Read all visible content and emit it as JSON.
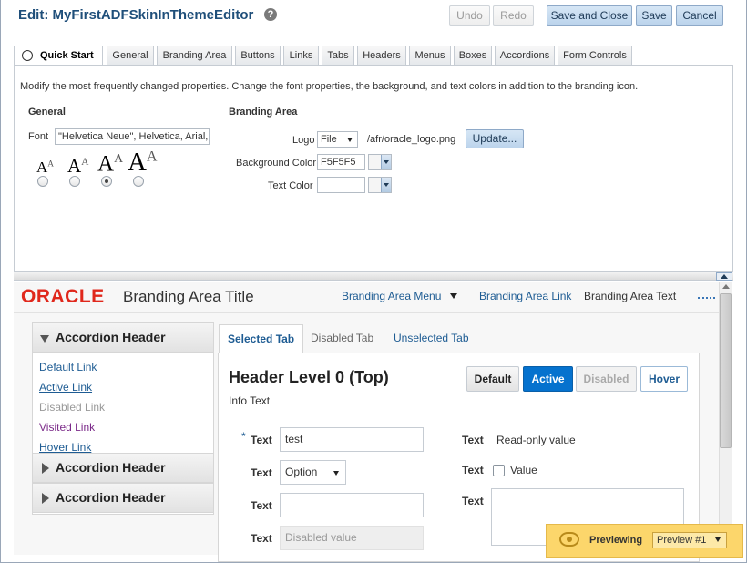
{
  "header": {
    "title": "Edit: MyFirstADFSkinInThemeEditor",
    "help_icon": "?",
    "undo_label": "Undo",
    "redo_label": "Redo",
    "save_close_label": "Save and Close",
    "save_label": "Save",
    "cancel_label": "Cancel"
  },
  "tabs": [
    "Quick Start",
    "General",
    "Branding Area",
    "Buttons",
    "Links",
    "Tabs",
    "Headers",
    "Menus",
    "Boxes",
    "Accordions",
    "Form Controls"
  ],
  "quick_start": {
    "description": "Modify the most frequently changed properties. Change the font properties, the background, and text colors in addition to the branding icon.",
    "general": {
      "title": "General",
      "font_label": "Font",
      "font_value": "\"Helvetica Neue\", Helvetica, Arial,",
      "font_size_glyph": "A",
      "font_size_selected_index": 2
    },
    "branding": {
      "title": "Branding Area",
      "logo_label": "Logo",
      "logo_source": "File",
      "logo_path": "/afr/oracle_logo.png",
      "update_label": "Update...",
      "bg_color_label": "Background Color",
      "bg_color_value": "F5F5F5",
      "text_color_label": "Text Color",
      "text_color_value": ""
    }
  },
  "preview": {
    "logo_text": "ORACLE",
    "branding_title": "Branding Area Title",
    "branding_menu": "Branding Area Menu",
    "branding_link": "Branding Area Link",
    "branding_text": "Branding Area Text",
    "accordion": {
      "header1": "Accordion Header",
      "header2": "Accordion Header",
      "header3": "Accordion Header",
      "links": [
        "Default Link",
        "Active Link",
        "Disabled Link",
        "Visited Link",
        "Hover Link"
      ]
    },
    "tabs": [
      "Selected Tab",
      "Disabled Tab",
      "Unselected Tab"
    ],
    "header_level": "Header Level 0 (Top)",
    "info_text": "Info Text",
    "state_buttons": [
      "Default",
      "Active",
      "Disabled",
      "Hover"
    ],
    "form": {
      "required_marker": "*",
      "label": "Text",
      "text_value": "test",
      "option_value": "Option",
      "empty_value": "",
      "disabled_value": "Disabled value",
      "readonly_value": "Read-only value",
      "checkbox_label": "Value"
    },
    "previewing_label": "Previewing",
    "preview_select": "Preview #1",
    "colors": {
      "oracle_red": "#e0281c",
      "link_blue": "#1e5c93",
      "active_blue": "#0572ce",
      "visited_purple": "#7b2a89",
      "preview_yellow": "#fcd66b"
    }
  }
}
